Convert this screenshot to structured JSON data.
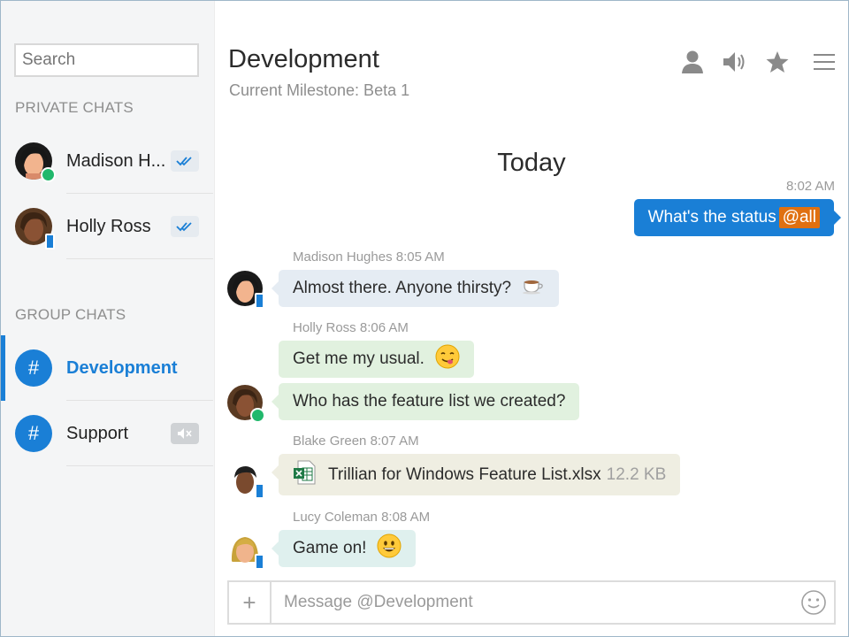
{
  "sidebar": {
    "search_placeholder": "Search",
    "private_title": "PRIVATE CHATS",
    "group_title": "GROUP CHATS",
    "private_chats": [
      {
        "name": "Madison H...",
        "status": "online"
      },
      {
        "name": "Holly Ross",
        "status": "mobile"
      }
    ],
    "group_chats": [
      {
        "symbol": "#",
        "name": "Development",
        "active": true
      },
      {
        "symbol": "#",
        "name": "Support",
        "muted": true
      }
    ]
  },
  "header": {
    "title": "Development",
    "subtitle": "Current Milestone: Beta 1",
    "icons": [
      "user-icon",
      "speaker-icon",
      "star-icon",
      "menu-icon"
    ]
  },
  "conversation": {
    "day": "Today",
    "messages": [
      {
        "direction": "out",
        "time": "8:02 AM",
        "text": "What's the status",
        "mention": "@all"
      },
      {
        "sender": "Madison Hughes",
        "time": "8:05 AM",
        "text": "Almost there. Anyone thirsty?",
        "emoji": "☕"
      },
      {
        "sender": "Holly Ross",
        "time": "8:06 AM",
        "text": "Get me my usual.",
        "emoji": "😋"
      },
      {
        "text": "Who has the feature list we created?"
      },
      {
        "sender": "Blake Green",
        "time": "8:07 AM",
        "file_name": "Trillian for Windows Feature List.xlsx",
        "file_size": "12.2 KB"
      },
      {
        "sender": "Lucy Coleman",
        "time": "8:08 AM",
        "text": "Game on!",
        "emoji": "😀"
      }
    ]
  },
  "composer": {
    "plus": "+",
    "placeholder": "Message @Development"
  },
  "colors": {
    "accent": "#1a7fd6",
    "online": "#21b86c",
    "mention": "#e07010",
    "bubble_madison": "#e5ecf3",
    "bubble_holly": "#e1f1df",
    "bubble_blake": "#efeee2",
    "bubble_lucy": "#dff0ee"
  }
}
